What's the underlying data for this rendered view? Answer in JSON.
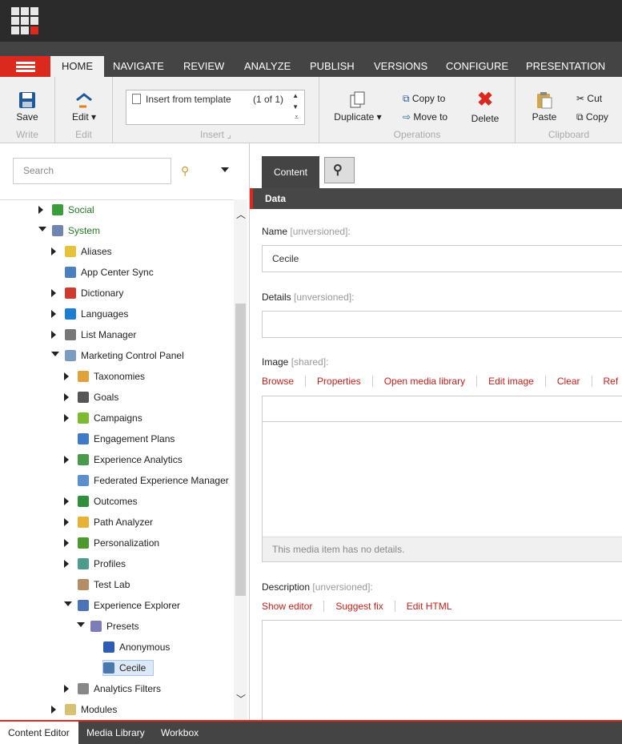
{
  "ribbon_tabs": [
    "HOME",
    "NAVIGATE",
    "REVIEW",
    "ANALYZE",
    "PUBLISH",
    "VERSIONS",
    "CONFIGURE",
    "PRESENTATION"
  ],
  "ribbon": {
    "save": "Save",
    "write": "Write",
    "edit": "Edit",
    "edit_group": "Edit",
    "insert_template": "Insert from template",
    "insert_count": "(1 of 1)",
    "insert_group": "Insert",
    "duplicate": "Duplicate",
    "copy_to": "Copy to",
    "move_to": "Move to",
    "delete": "Delete",
    "operations": "Operations",
    "paste": "Paste",
    "cut": "Cut",
    "copy": "Copy",
    "clipboard": "Clipboard"
  },
  "search": {
    "placeholder": "Search"
  },
  "tree": [
    {
      "label": "Social",
      "state": "collapsed",
      "color": "green"
    },
    {
      "label": "System",
      "state": "expanded",
      "color": "green"
    },
    {
      "label": "Aliases",
      "state": "collapsed"
    },
    {
      "label": "App Center Sync",
      "state": "leaf"
    },
    {
      "label": "Dictionary",
      "state": "collapsed"
    },
    {
      "label": "Languages",
      "state": "collapsed"
    },
    {
      "label": "List Manager",
      "state": "collapsed"
    },
    {
      "label": "Marketing Control Panel",
      "state": "expanded"
    },
    {
      "label": "Taxonomies",
      "state": "collapsed"
    },
    {
      "label": "Goals",
      "state": "collapsed"
    },
    {
      "label": "Campaigns",
      "state": "collapsed"
    },
    {
      "label": "Engagement Plans",
      "state": "leaf"
    },
    {
      "label": "Experience Analytics",
      "state": "collapsed"
    },
    {
      "label": "Federated Experience Manager",
      "state": "leaf"
    },
    {
      "label": "Outcomes",
      "state": "collapsed"
    },
    {
      "label": "Path Analyzer",
      "state": "collapsed"
    },
    {
      "label": "Personalization",
      "state": "collapsed"
    },
    {
      "label": "Profiles",
      "state": "collapsed"
    },
    {
      "label": "Test Lab",
      "state": "leaf"
    },
    {
      "label": "Experience Explorer",
      "state": "expanded"
    },
    {
      "label": "Presets",
      "state": "expanded"
    },
    {
      "label": "Anonymous",
      "state": "leaf"
    },
    {
      "label": "Cecile",
      "state": "leaf",
      "selected": true
    },
    {
      "label": "Analytics Filters",
      "state": "collapsed"
    },
    {
      "label": "Modules",
      "state": "collapsed"
    }
  ],
  "editor": {
    "tab_content": "Content",
    "section": "Data",
    "name_label": "Name",
    "name_tag": "[unversioned]:",
    "name_value": "Cecile",
    "details_label": "Details",
    "details_tag": "[unversioned]:",
    "details_value": "",
    "image_label": "Image",
    "image_tag": "[shared]:",
    "image_links": [
      "Browse",
      "Properties",
      "Open media library",
      "Edit image",
      "Clear",
      "Ref"
    ],
    "image_note": "This media item has no details.",
    "desc_label": "Description",
    "desc_tag": "[unversioned]:",
    "desc_links": [
      "Show editor",
      "Suggest fix",
      "Edit HTML"
    ]
  },
  "bottom_tabs": [
    "Content Editor",
    "Media Library",
    "Workbox"
  ]
}
